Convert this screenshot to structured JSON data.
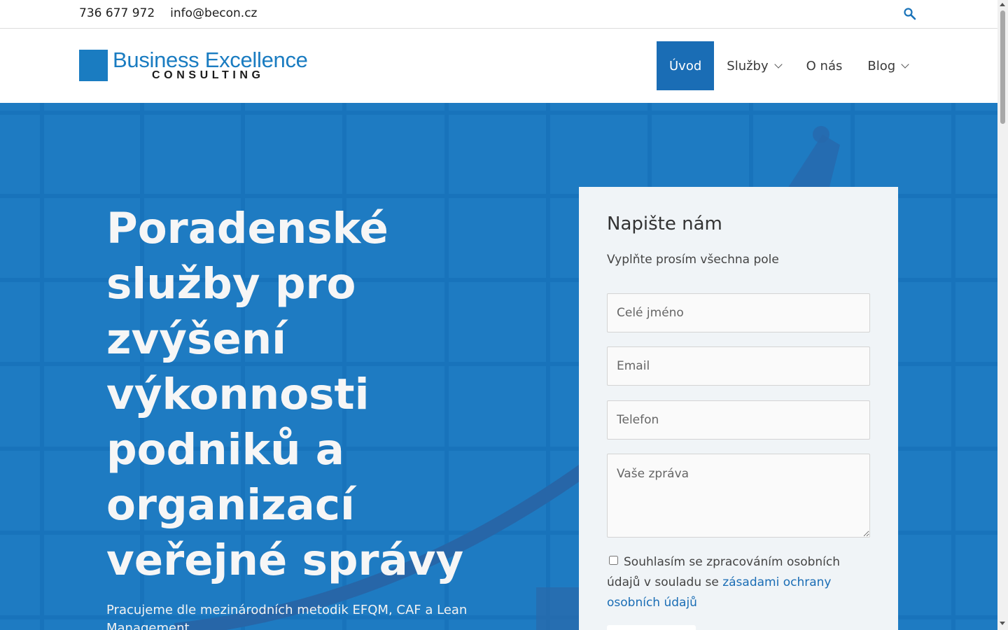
{
  "topbar": {
    "phone": "736 677 972",
    "email": "info@becon.cz",
    "search_icon": "search-icon"
  },
  "header": {
    "logo_line1": "Business Excellence",
    "logo_line2": "CONSULTING",
    "nav": [
      {
        "label": "Úvod",
        "active": true,
        "has_dropdown": false
      },
      {
        "label": "Služby",
        "active": false,
        "has_dropdown": true
      },
      {
        "label": "O nás",
        "active": false,
        "has_dropdown": false
      },
      {
        "label": "Blog",
        "active": false,
        "has_dropdown": true
      }
    ]
  },
  "hero": {
    "title": "Poradenské služby pro zvýšení výkonnosti podniků a organizací veřejné správy",
    "subtitle": "Pracujeme dle mezinárodních metodik EFQM, CAF a Lean Management"
  },
  "form": {
    "title": "Napište nám",
    "hint": "Vyplňte prosím všechna pole",
    "name_placeholder": "Celé jméno",
    "email_placeholder": "Email",
    "phone_placeholder": "Telefon",
    "message_placeholder": "Vaše zpráva",
    "consent_text": "Souhlasím se zpracováním osobních údajů v souladu se",
    "consent_link": "zásadami ochrany osobních údajů",
    "consent_checked": false
  },
  "colors": {
    "brand": "#1a7cc1",
    "hero_bg": "#1e7bc2",
    "nav_active": "#1a6db5"
  }
}
